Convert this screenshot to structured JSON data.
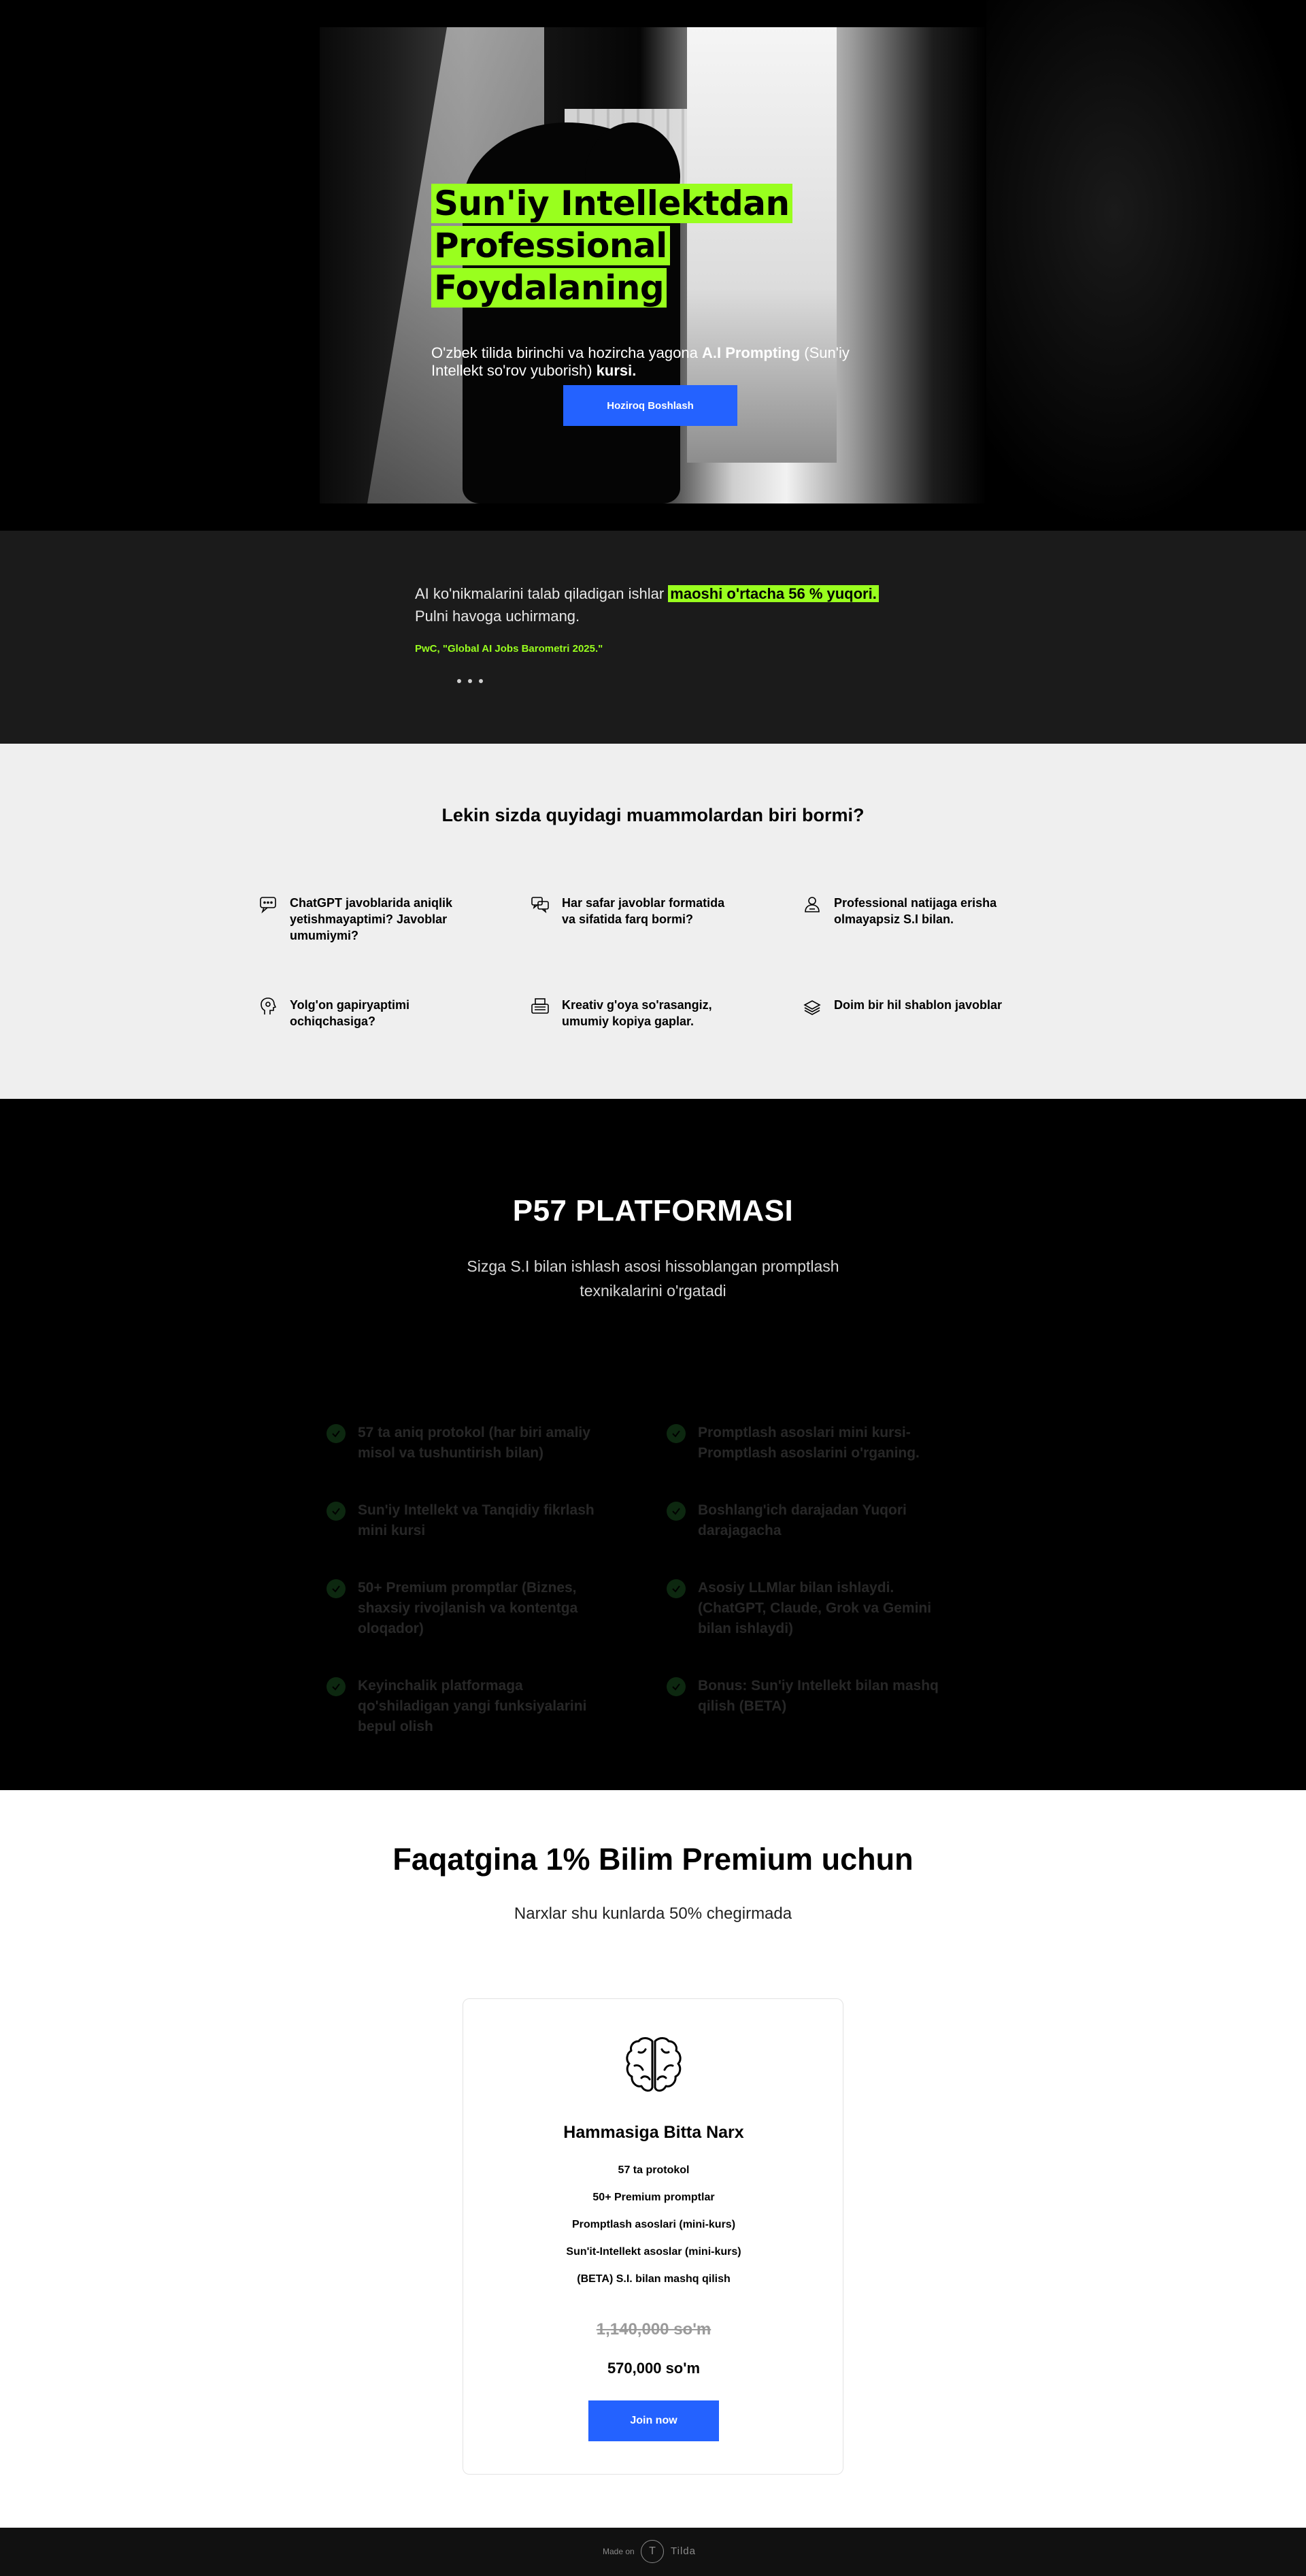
{
  "hero": {
    "title_line1": "Sun'iy Intellektdan",
    "title_line2": "Professional Foydalaning",
    "subtitle_pre": "O'zbek tilida birinchi va hozircha yagona ",
    "subtitle_bold1": "A.I Prompting",
    "subtitle_mid": " (Sun'iy Intellekt so'rov yuborish) ",
    "subtitle_bold2": "kursi.",
    "cta_label": "Hoziroq Boshlash",
    "accent": "#99ff1e",
    "button_color": "#2462ff"
  },
  "quote": {
    "text_pre": "AI ko'nikmalarini talab qiladigan ishlar ",
    "text_highlight": "maoshi o'rtacha 56 % yuqori.",
    "text_post": "Pulni havoga uchirmang.",
    "source": "PwC, \"Global AI Jobs Barometri 2025.\""
  },
  "problems": {
    "title": "Lekin sizda quyidagi muammolardan biri bormi?",
    "items": [
      {
        "icon": "chat-bubble-icon",
        "text": "ChatGPT javoblarida aniqlik yetishmayaptimi? Javoblar umumiymi?"
      },
      {
        "icon": "speech-bubbles-icon",
        "text": "Har safar javoblar formatida va sifatida farq bormi?"
      },
      {
        "icon": "person-icon",
        "text": "Professional natijaga erisha olmayapsiz S.I bilan."
      },
      {
        "icon": "head-profile-icon",
        "text": "Yolg'on gapiryaptimi ochiqchasiga?"
      },
      {
        "icon": "typewriter-icon",
        "text": "Kreativ g'oya so'rasangiz, umumiy kopiya gaplar."
      },
      {
        "icon": "stack-icon",
        "text": "Doim bir hil shablon javoblar"
      }
    ]
  },
  "platform": {
    "title": "P57 PLATFORMASI",
    "subtitle": "Sizga S.I bilan ishlash asosi hissoblangan promptlash texnikalarini o'rgatadi",
    "features": [
      "57 ta aniq protokol (har biri amaliy misol va tushuntirish bilan)",
      "Promptlash asoslari mini kursi- Promptlash asoslarini o'rganing.",
      "Sun'iy Intellekt va Tanqidiy fikrlash mini kursi",
      "Boshlang'ich darajadan Yuqori darajagacha",
      "50+ Premium promptlar (Biznes, shaxsiy rivojlanish va kontentga oloqador)",
      "Asosiy LLMlar bilan ishlaydi. (ChatGPT, Claude, Grok va Gemini bilan ishlaydi)",
      "Keyinchalik platformaga qo'shiladigan yangi funksiyalarini bepul olish",
      "Bonus: Sun'iy Intellekt bilan mashq qilish (BETA)"
    ]
  },
  "pricing": {
    "title": "Faqatgina 1% Bilim Premium uchun",
    "subtitle": "Narxlar shu kunlarda 50% chegirmada",
    "card_icon": "brain-icon",
    "card_title": "Hammasiga Bitta Narx",
    "includes": [
      "57 ta protokol",
      "50+ Premium promptlar",
      "Promptlash asoslari (mini-kurs)",
      "Sun'it-Intellekt asoslar (mini-kurs)",
      "(BETA) S.I. bilan mashq qilish"
    ],
    "old_price": "1,140,000 so'm",
    "new_price": "570,000 so'm",
    "cta_label": "Join now"
  },
  "footer": {
    "made_on": "Made on",
    "logo_letter": "T",
    "brand": "Tilda"
  }
}
